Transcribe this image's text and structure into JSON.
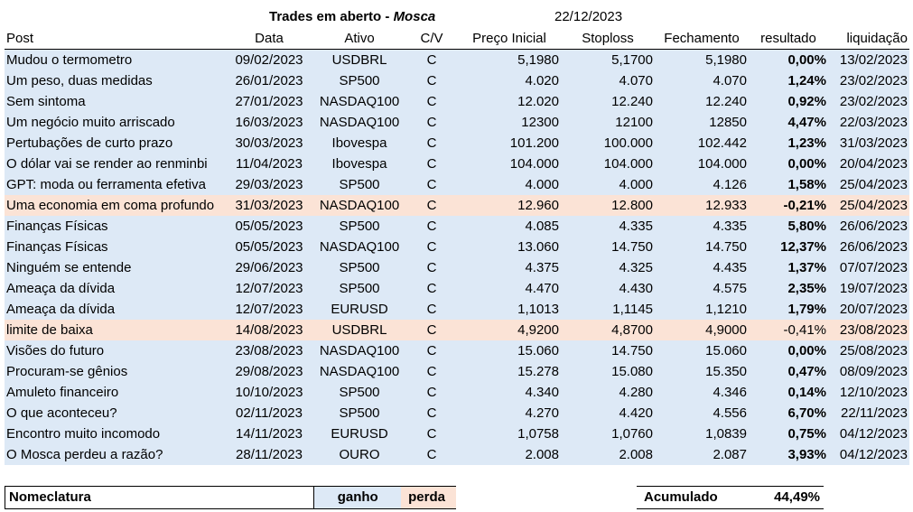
{
  "header": {
    "title_prefix": "Trades em aberto - ",
    "title_accent": "Mosca",
    "date": "22/12/2023"
  },
  "columns": [
    "Post",
    "Data",
    "Ativo",
    "C/V",
    "Preço Inicial",
    "Stoploss",
    "Fechamento",
    "resultado",
    "liquidação"
  ],
  "rows": [
    {
      "post": "Mudou o termometro",
      "data": "09/02/2023",
      "ativo": "USDBRL",
      "cv": "C",
      "preco": "5,1980",
      "stop": "5,1700",
      "fech": "5,1980",
      "res": "0,00%",
      "liq": "13/02/2023",
      "type": "gain",
      "bold": true
    },
    {
      "post": "Um peso, duas medidas",
      "data": "26/01/2023",
      "ativo": "SP500",
      "cv": "C",
      "preco": "4.020",
      "stop": "4.070",
      "fech": "4.070",
      "res": "1,24%",
      "liq": "23/02/2023",
      "type": "gain",
      "bold": true
    },
    {
      "post": "Sem sintoma",
      "data": "27/01/2023",
      "ativo": "NASDAQ100",
      "cv": "C",
      "preco": "12.020",
      "stop": "12.240",
      "fech": "12.240",
      "res": "0,92%",
      "liq": "23/02/2023",
      "type": "gain",
      "bold": true
    },
    {
      "post": "Um negócio muito arriscado",
      "data": "16/03/2023",
      "ativo": "NASDAQ100",
      "cv": "C",
      "preco": "12300",
      "stop": "12100",
      "fech": "12850",
      "res": "4,47%",
      "liq": "22/03/2023",
      "type": "gain",
      "bold": true
    },
    {
      "post": "Pertubações de curto prazo",
      "data": "30/03/2023",
      "ativo": "Ibovespa",
      "cv": "C",
      "preco": "101.200",
      "stop": "100.000",
      "fech": "102.442",
      "res": "1,23%",
      "liq": "31/03/2023",
      "type": "gain",
      "bold": true
    },
    {
      "post": "O dólar vai se render ao renminbi",
      "data": "11/04/2023",
      "ativo": "Ibovespa",
      "cv": "C",
      "preco": "104.000",
      "stop": "104.000",
      "fech": "104.000",
      "res": "0,00%",
      "liq": "20/04/2023",
      "type": "gain",
      "bold": true
    },
    {
      "post": "GPT: moda ou ferramenta efetiva",
      "data": "29/03/2023",
      "ativo": "SP500",
      "cv": "C",
      "preco": "4.000",
      "stop": "4.000",
      "fech": "4.126",
      "res": "1,58%",
      "liq": "25/04/2023",
      "type": "gain",
      "bold": true
    },
    {
      "post": "Uma economia em coma profundo",
      "data": "31/03/2023",
      "ativo": "NASDAQ100",
      "cv": "C",
      "preco": "12.960",
      "stop": "12.800",
      "fech": "12.933",
      "res": "-0,21%",
      "liq": "25/04/2023",
      "type": "loss",
      "bold": true
    },
    {
      "post": "Finanças Físicas",
      "data": "05/05/2023",
      "ativo": "SP500",
      "cv": "C",
      "preco": "4.085",
      "stop": "4.335",
      "fech": "4.335",
      "res": "5,80%",
      "liq": "26/06/2023",
      "type": "gain",
      "bold": true
    },
    {
      "post": "Finanças Físicas",
      "data": "05/05/2023",
      "ativo": "NASDAQ100",
      "cv": "C",
      "preco": "13.060",
      "stop": "14.750",
      "fech": "14.750",
      "res": "12,37%",
      "liq": "26/06/2023",
      "type": "gain",
      "bold": true
    },
    {
      "post": "Ninguém se entende",
      "data": "29/06/2023",
      "ativo": "SP500",
      "cv": "C",
      "preco": "4.375",
      "stop": "4.325",
      "fech": "4.435",
      "res": "1,37%",
      "liq": "07/07/2023",
      "type": "gain",
      "bold": true
    },
    {
      "post": "Ameaça da dívida",
      "data": "12/07/2023",
      "ativo": "SP500",
      "cv": "C",
      "preco": "4.470",
      "stop": "4.430",
      "fech": "4.575",
      "res": "2,35%",
      "liq": "19/07/2023",
      "type": "gain",
      "bold": true
    },
    {
      "post": "Ameaça da dívida",
      "data": "12/07/2023",
      "ativo": "EURUSD",
      "cv": "C",
      "preco": "1,1013",
      "stop": "1,1145",
      "fech": "1,1210",
      "res": "1,79%",
      "liq": "20/07/2023",
      "type": "gain",
      "bold": true
    },
    {
      "post": "limite de baixa",
      "data": "14/08/2023",
      "ativo": "USDBRL",
      "cv": "C",
      "preco": "4,9200",
      "stop": "4,8700",
      "fech": "4,9000",
      "res": "-0,41%",
      "liq": "23/08/2023",
      "type": "loss",
      "bold": false
    },
    {
      "post": "Visões do futuro",
      "data": "23/08/2023",
      "ativo": "NASDAQ100",
      "cv": "C",
      "preco": "15.060",
      "stop": "14.750",
      "fech": "15.060",
      "res": "0,00%",
      "liq": "25/08/2023",
      "type": "gain",
      "bold": true
    },
    {
      "post": "Procuram-se gênios",
      "data": "29/08/2023",
      "ativo": "NASDAQ100",
      "cv": "C",
      "preco": "15.278",
      "stop": "15.080",
      "fech": "15.350",
      "res": "0,47%",
      "liq": "08/09/2023",
      "type": "gain",
      "bold": true
    },
    {
      "post": "Amuleto financeiro",
      "data": "10/10/2023",
      "ativo": "SP500",
      "cv": "C",
      "preco": "4.340",
      "stop": "4.280",
      "fech": "4.346",
      "res": "0,14%",
      "liq": "12/10/2023",
      "type": "gain",
      "bold": true
    },
    {
      "post": "O que aconteceu?",
      "data": "02/11/2023",
      "ativo": "SP500",
      "cv": "C",
      "preco": "4.270",
      "stop": "4.420",
      "fech": "4.556",
      "res": "6,70%",
      "liq": "22/11/2023",
      "type": "gain",
      "bold": true
    },
    {
      "post": "Encontro muito incomodo",
      "data": "14/11/2023",
      "ativo": "EURUSD",
      "cv": "C",
      "preco": "1,0758",
      "stop": "1,0760",
      "fech": "1,0839",
      "res": "0,75%",
      "liq": "04/12/2023",
      "type": "gain",
      "bold": true
    },
    {
      "post": "O Mosca perdeu a razão?",
      "data": "28/11/2023",
      "ativo": "OURO",
      "cv": "C",
      "preco": "2.008",
      "stop": "2.008",
      "fech": "2.087",
      "res": "3,93%",
      "liq": "04/12/2023",
      "type": "gain",
      "bold": true
    }
  ],
  "legend": {
    "label": "Nomeclatura",
    "gain": "ganho",
    "loss": "perda",
    "gain_color": "#dde9f6",
    "loss_color": "#fbe3d6"
  },
  "summary": {
    "label": "Acumulado",
    "value": "44,49%"
  }
}
